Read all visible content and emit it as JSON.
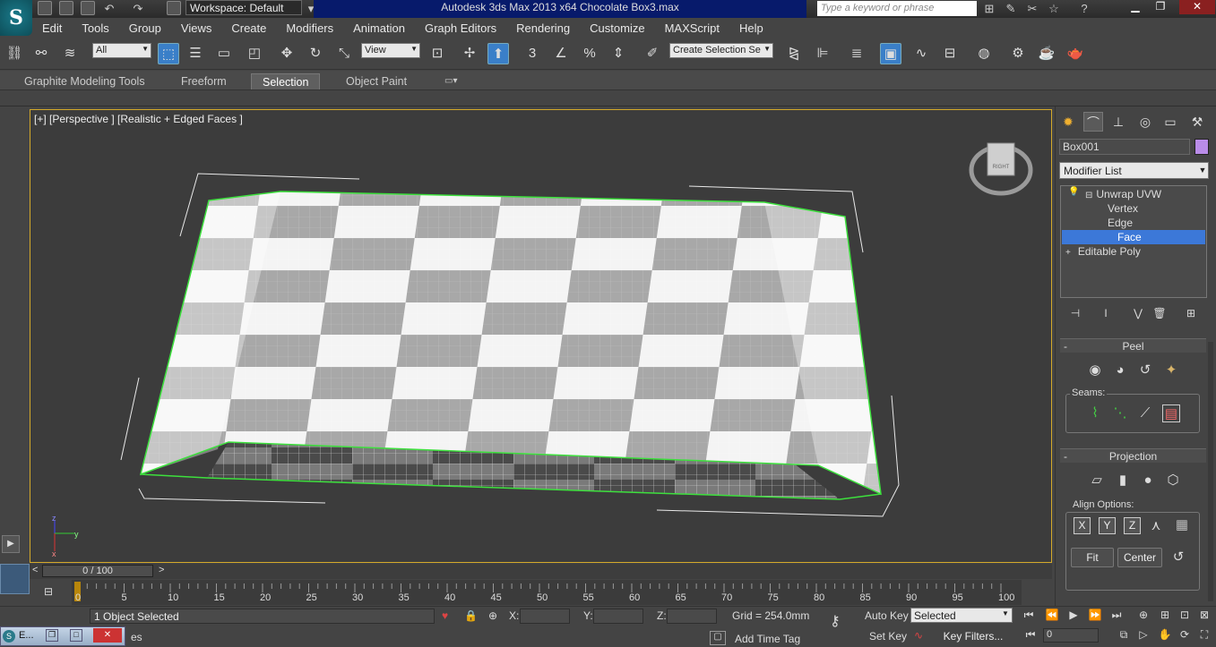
{
  "title_bar": {
    "logo": "S",
    "workspace": "Workspace: Default",
    "app_title": "Autodesk 3ds Max  2013 x64     Chocolate Box3.max",
    "search_placeholder": "Type a keyword or phrase"
  },
  "menu": [
    "Edit",
    "Tools",
    "Group",
    "Views",
    "Create",
    "Modifiers",
    "Animation",
    "Graph Editors",
    "Rendering",
    "Customize",
    "MAXScript",
    "Help"
  ],
  "toolbar": {
    "filter": "All",
    "ref_coord": "View",
    "snap_3": "3",
    "named_selection": "Create Selection Se"
  },
  "ribbon_tabs": [
    "Graphite Modeling Tools",
    "Freeform",
    "Selection",
    "Object Paint"
  ],
  "viewport": {
    "label": "[+] [Perspective ] [Realistic + Edged Faces ]",
    "viewcube_face": "RIGHT",
    "axis_z": "z",
    "axis_y": "y",
    "axis_x": "x"
  },
  "command_panel": {
    "object_name": "Box001",
    "object_color": "#b98ce8",
    "modifier_list": "Modifier List",
    "stack": [
      {
        "label": "Unwrap UVW",
        "toggle": "⊟"
      },
      {
        "label": "Vertex"
      },
      {
        "label": "Edge"
      },
      {
        "label": "Face",
        "selected": true
      },
      {
        "label": "Editable Poly",
        "toggle": "+"
      }
    ],
    "peel": {
      "header": "Peel",
      "seams_label": "Seams:"
    },
    "projection": {
      "header": "Projection",
      "align_label": "Align Options:",
      "x": "X",
      "y": "Y",
      "z": "Z",
      "fit": "Fit",
      "center": "Center"
    }
  },
  "timeline": {
    "slider": "0 / 100",
    "prev": "<",
    "next": ">",
    "ticks": [
      "0",
      "5",
      "10",
      "15",
      "20",
      "25",
      "30",
      "35",
      "40",
      "45",
      "50",
      "55",
      "60",
      "65",
      "70",
      "75",
      "80",
      "85",
      "90",
      "95",
      "100"
    ]
  },
  "status": {
    "selection": "1 Object Selected",
    "x_label": "X:",
    "y_label": "Y:",
    "z_label": "Z:",
    "grid": "Grid = 254.0mm",
    "auto_key": "Auto Key",
    "set_key": "Set Key",
    "key_mode": "Selected",
    "key_filters": "Key Filters...",
    "frame": "0",
    "add_time_tag": "Add Time Tag",
    "prompt_tail": "es"
  },
  "taskbar": {
    "label": "E..."
  }
}
